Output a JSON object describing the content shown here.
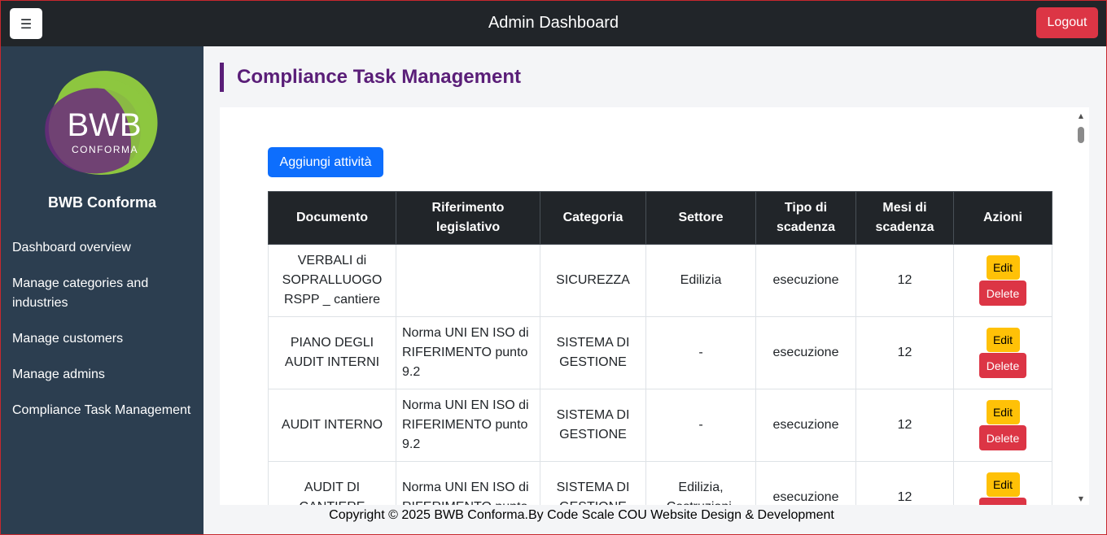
{
  "header": {
    "menu_icon": "hamburger-icon",
    "menu_glyph": "☰",
    "title": "Admin Dashboard",
    "logout_label": "Logout"
  },
  "sidebar": {
    "logo_text": "BWB",
    "logo_subtext": "CONFORMA",
    "brand_name": "BWB Conforma",
    "items": [
      {
        "label": "Dashboard overview"
      },
      {
        "label": "Manage categories and industries"
      },
      {
        "label": "Manage customers"
      },
      {
        "label": "Manage admins"
      },
      {
        "label": "Compliance Task Management"
      }
    ]
  },
  "main": {
    "page_title": "Compliance Task Management",
    "add_button_label": "Aggiungi attività",
    "table": {
      "headers": [
        "Documento",
        "Riferimento legislativo",
        "Categoria",
        "Settore",
        "Tipo di scadenza",
        "Mesi di scadenza",
        "Azioni"
      ],
      "rows": [
        {
          "documento": "VERBALI di SOPRALLUOGO RSPP _ cantiere",
          "riferimento": "",
          "categoria": "SICUREZZA",
          "settore": "Edilizia",
          "tipo": "esecuzione",
          "mesi": "12"
        },
        {
          "documento": "PIANO DEGLI AUDIT INTERNI",
          "riferimento": "Norma UNI EN ISO di RIFERIMENTO punto 9.2",
          "categoria": "SISTEMA DI GESTIONE",
          "settore": "-",
          "tipo": "esecuzione",
          "mesi": "12"
        },
        {
          "documento": "AUDIT INTERNO",
          "riferimento": "Norma UNI EN ISO di RIFERIMENTO punto 9.2",
          "categoria": "SISTEMA DI GESTIONE",
          "settore": "-",
          "tipo": "esecuzione",
          "mesi": "12"
        },
        {
          "documento": "AUDIT DI CANTIERE",
          "riferimento": "Norma UNI EN ISO di RIFERIMENTO punto",
          "categoria": "SISTEMA DI GESTIONE",
          "settore": "Edilizia, Costruzioni,",
          "tipo": "esecuzione",
          "mesi": "12"
        }
      ],
      "edit_label": "Edit",
      "delete_label": "Delete"
    }
  },
  "footer": {
    "text": "Copyright © 2025 BWB Conforma.By Code Scale COU Website Design & Development"
  },
  "colors": {
    "topbar": "#212529",
    "sidebar": "#2c3e50",
    "accent_purple": "#5a1e78",
    "primary": "#0d6efd",
    "danger": "#dc3545",
    "warning": "#ffc107"
  }
}
